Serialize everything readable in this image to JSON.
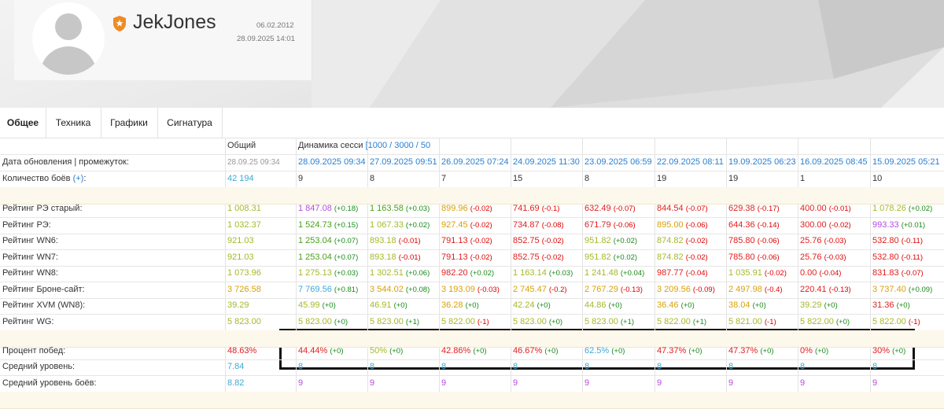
{
  "profile": {
    "username": "JekJones",
    "registered": "06.02.2012",
    "last_seen": "28.09.2025 14:01"
  },
  "tabs": [
    {
      "label": "Общее",
      "active": true
    },
    {
      "label": "Техника",
      "active": false
    },
    {
      "label": "Графики",
      "active": false
    },
    {
      "label": "Сигнатура",
      "active": false
    }
  ],
  "table": {
    "header": {
      "overall": "Общий",
      "dynamics": "Динамика сесси",
      "dynamics_link": "[1000 / 3000 / 50"
    },
    "update_row": {
      "label": "Дата обновления | промежуток:",
      "overall": "28.09.25 09:34",
      "dates": [
        "28.09.2025 09:34",
        "27.09.2025 09:51",
        "26.09.2025 07:24",
        "24.09.2025 11:30",
        "23.09.2025 06:59",
        "22.09.2025 08:11",
        "19.09.2025 06:23",
        "16.09.2025 08:45",
        "15.09.2025 05:21"
      ]
    },
    "battles_row": {
      "label": "Количество боёв",
      "plus": "(+)",
      "suffix": ":",
      "overall": "42 194",
      "values": [
        "9",
        "8",
        "7",
        "15",
        "8",
        "19",
        "19",
        "1",
        "10"
      ]
    },
    "ratings": [
      {
        "label": "Рейтинг РЭ старый:",
        "overall": "1 008.31",
        "overall_color": "#a6b82a",
        "cells": [
          {
            "v": "1 847.08",
            "c": "#b34ce0",
            "d": "(+0.18)",
            "s": "pos"
          },
          {
            "v": "1 163.58",
            "c": "#4a9e1a",
            "d": "(+0.03)",
            "s": "pos"
          },
          {
            "v": "899.96",
            "c": "#d8a10a",
            "d": "(-0.02)",
            "s": "neg"
          },
          {
            "v": "741.69",
            "c": "#e02020",
            "d": "(-0.1)",
            "s": "neg"
          },
          {
            "v": "632.49",
            "c": "#e02020",
            "d": "(-0.07)",
            "s": "neg"
          },
          {
            "v": "844.54",
            "c": "#e02020",
            "d": "(-0.07)",
            "s": "neg"
          },
          {
            "v": "629.38",
            "c": "#e02020",
            "d": "(-0.17)",
            "s": "neg"
          },
          {
            "v": "400.00",
            "c": "#e02020",
            "d": "(-0.01)",
            "s": "neg"
          },
          {
            "v": "1 078.26",
            "c": "#a6b82a",
            "d": "(+0.02)",
            "s": "pos"
          }
        ]
      },
      {
        "label": "Рейтинг РЭ:",
        "overall": "1 032.37",
        "overall_color": "#a6b82a",
        "cells": [
          {
            "v": "1 524.73",
            "c": "#4a9e1a",
            "d": "(+0.15)",
            "s": "pos"
          },
          {
            "v": "1 067.33",
            "c": "#a6b82a",
            "d": "(+0.02)",
            "s": "pos"
          },
          {
            "v": "927.45",
            "c": "#d8a10a",
            "d": "(-0.02)",
            "s": "neg"
          },
          {
            "v": "734.87",
            "c": "#e02020",
            "d": "(-0.08)",
            "s": "neg"
          },
          {
            "v": "671.79",
            "c": "#e02020",
            "d": "(-0.06)",
            "s": "neg"
          },
          {
            "v": "895.00",
            "c": "#d8a10a",
            "d": "(-0.06)",
            "s": "neg"
          },
          {
            "v": "644.36",
            "c": "#e02020",
            "d": "(-0.14)",
            "s": "neg"
          },
          {
            "v": "300.00",
            "c": "#e02020",
            "d": "(-0.02)",
            "s": "neg"
          },
          {
            "v": "993.33",
            "c": "#b34ce0",
            "d": "(+0.01)",
            "s": "pos"
          }
        ]
      },
      {
        "label": "Рейтинг WN6:",
        "overall": "921.03",
        "overall_color": "#a6b82a",
        "cells": [
          {
            "v": "1 253.04",
            "c": "#4a9e1a",
            "d": "(+0.07)",
            "s": "pos"
          },
          {
            "v": "893.18",
            "c": "#a6b82a",
            "d": "(-0.01)",
            "s": "neg"
          },
          {
            "v": "791.13",
            "c": "#e02020",
            "d": "(-0.02)",
            "s": "neg"
          },
          {
            "v": "852.75",
            "c": "#e02020",
            "d": "(-0.02)",
            "s": "neg"
          },
          {
            "v": "951.82",
            "c": "#a6b82a",
            "d": "(+0.02)",
            "s": "pos"
          },
          {
            "v": "874.82",
            "c": "#a6b82a",
            "d": "(-0.02)",
            "s": "neg"
          },
          {
            "v": "785.80",
            "c": "#e02020",
            "d": "(-0.06)",
            "s": "neg"
          },
          {
            "v": "25.76",
            "c": "#e02020",
            "d": "(-0.03)",
            "s": "neg"
          },
          {
            "v": "532.80",
            "c": "#e02020",
            "d": "(-0.11)",
            "s": "neg"
          }
        ]
      },
      {
        "label": "Рейтинг WN7:",
        "overall": "921.03",
        "overall_color": "#a6b82a",
        "cells": [
          {
            "v": "1 253.04",
            "c": "#4a9e1a",
            "d": "(+0.07)",
            "s": "pos"
          },
          {
            "v": "893.18",
            "c": "#a6b82a",
            "d": "(-0.01)",
            "s": "neg"
          },
          {
            "v": "791.13",
            "c": "#e02020",
            "d": "(-0.02)",
            "s": "neg"
          },
          {
            "v": "852.75",
            "c": "#e02020",
            "d": "(-0.02)",
            "s": "neg"
          },
          {
            "v": "951.82",
            "c": "#a6b82a",
            "d": "(+0.02)",
            "s": "pos"
          },
          {
            "v": "874.82",
            "c": "#a6b82a",
            "d": "(-0.02)",
            "s": "neg"
          },
          {
            "v": "785.80",
            "c": "#e02020",
            "d": "(-0.06)",
            "s": "neg"
          },
          {
            "v": "25.76",
            "c": "#e02020",
            "d": "(-0.03)",
            "s": "neg"
          },
          {
            "v": "532.80",
            "c": "#e02020",
            "d": "(-0.11)",
            "s": "neg"
          }
        ]
      },
      {
        "label": "Рейтинг WN8:",
        "overall": "1 073.96",
        "overall_color": "#a6b82a",
        "cells": [
          {
            "v": "1 275.13",
            "c": "#a6b82a",
            "d": "(+0.03)",
            "s": "pos"
          },
          {
            "v": "1 302.51",
            "c": "#a6b82a",
            "d": "(+0.06)",
            "s": "pos"
          },
          {
            "v": "982.20",
            "c": "#e02020",
            "d": "(+0.02)",
            "s": "pos"
          },
          {
            "v": "1 163.14",
            "c": "#a6b82a",
            "d": "(+0.03)",
            "s": "pos"
          },
          {
            "v": "1 241.48",
            "c": "#a6b82a",
            "d": "(+0.04)",
            "s": "pos"
          },
          {
            "v": "987.77",
            "c": "#e02020",
            "d": "(-0.04)",
            "s": "neg"
          },
          {
            "v": "1 035.91",
            "c": "#a6b82a",
            "d": "(-0.02)",
            "s": "neg"
          },
          {
            "v": "0.00",
            "c": "#e02020",
            "d": "(-0.04)",
            "s": "neg"
          },
          {
            "v": "831.83",
            "c": "#e02020",
            "d": "(-0.07)",
            "s": "neg"
          }
        ]
      },
      {
        "label": "Рейтинг Броне-сайт:",
        "overall": "3 726.58",
        "overall_color": "#d8a10a",
        "cells": [
          {
            "v": "7 769.56",
            "c": "#3fa8d6",
            "d": "(+0.81)",
            "s": "pos"
          },
          {
            "v": "3 544.02",
            "c": "#d8a10a",
            "d": "(+0.08)",
            "s": "pos"
          },
          {
            "v": "3 193.09",
            "c": "#d8a10a",
            "d": "(-0.03)",
            "s": "neg"
          },
          {
            "v": "2 745.47",
            "c": "#d8a10a",
            "d": "(-0.2)",
            "s": "neg"
          },
          {
            "v": "2 767.29",
            "c": "#d8a10a",
            "d": "(-0.13)",
            "s": "neg"
          },
          {
            "v": "3 209.56",
            "c": "#d8a10a",
            "d": "(-0.09)",
            "s": "neg"
          },
          {
            "v": "2 497.98",
            "c": "#d8a10a",
            "d": "(-0.4)",
            "s": "neg"
          },
          {
            "v": "220.41",
            "c": "#e02020",
            "d": "(-0.13)",
            "s": "neg"
          },
          {
            "v": "3 737.40",
            "c": "#d8a10a",
            "d": "(+0.09)",
            "s": "pos"
          }
        ]
      },
      {
        "label": "Рейтинг XVM (WN8):",
        "overall": "39.29",
        "overall_color": "#a6b82a",
        "cells": [
          {
            "v": "45.99",
            "c": "#a6b82a",
            "d": "(+0)",
            "s": "pos"
          },
          {
            "v": "46.91",
            "c": "#a6b82a",
            "d": "(+0)",
            "s": "pos"
          },
          {
            "v": "36.28",
            "c": "#d8a10a",
            "d": "(+0)",
            "s": "pos"
          },
          {
            "v": "42.24",
            "c": "#a6b82a",
            "d": "(+0)",
            "s": "pos"
          },
          {
            "v": "44.86",
            "c": "#a6b82a",
            "d": "(+0)",
            "s": "pos"
          },
          {
            "v": "36.46",
            "c": "#d8a10a",
            "d": "(+0)",
            "s": "pos"
          },
          {
            "v": "38.04",
            "c": "#d8a10a",
            "d": "(+0)",
            "s": "pos"
          },
          {
            "v": "39.29",
            "c": "#a6b82a",
            "d": "(+0)",
            "s": "pos"
          },
          {
            "v": "31.36",
            "c": "#e02020",
            "d": "(+0)",
            "s": "pos"
          }
        ]
      },
      {
        "label": "Рейтинг WG:",
        "overall": "5 823.00",
        "overall_color": "#a6b82a",
        "cells": [
          {
            "v": "5 823.00",
            "c": "#a6b82a",
            "d": "(+0)",
            "s": "pos"
          },
          {
            "v": "5 823.00",
            "c": "#a6b82a",
            "d": "(+1)",
            "s": "pos"
          },
          {
            "v": "5 822.00",
            "c": "#a6b82a",
            "d": "(-1)",
            "s": "neg"
          },
          {
            "v": "5 823.00",
            "c": "#a6b82a",
            "d": "(+0)",
            "s": "pos"
          },
          {
            "v": "5 823.00",
            "c": "#a6b82a",
            "d": "(+1)",
            "s": "pos"
          },
          {
            "v": "5 822.00",
            "c": "#a6b82a",
            "d": "(+1)",
            "s": "pos"
          },
          {
            "v": "5 821.00",
            "c": "#a6b82a",
            "d": "(-1)",
            "s": "neg"
          },
          {
            "v": "5 822.00",
            "c": "#a6b82a",
            "d": "(+0)",
            "s": "pos"
          },
          {
            "v": "5 822.00",
            "c": "#a6b82a",
            "d": "(-1)",
            "s": "neg"
          }
        ]
      }
    ],
    "winrate": {
      "label": "Процент побед:",
      "overall": "48.63%",
      "overall_color": "#e02020",
      "cells": [
        {
          "v": "44.44%",
          "c": "#e02020",
          "d": "(+0)",
          "s": "pos"
        },
        {
          "v": "50%",
          "c": "#a6b82a",
          "d": "(+0)",
          "s": "pos"
        },
        {
          "v": "42.86%",
          "c": "#e02020",
          "d": "(+0)",
          "s": "pos"
        },
        {
          "v": "46.67%",
          "c": "#e02020",
          "d": "(+0)",
          "s": "pos"
        },
        {
          "v": "62.5%",
          "c": "#3fa8d6",
          "d": "(+0)",
          "s": "pos"
        },
        {
          "v": "47.37%",
          "c": "#e02020",
          "d": "(+0)",
          "s": "pos"
        },
        {
          "v": "47.37%",
          "c": "#e02020",
          "d": "(+0)",
          "s": "pos"
        },
        {
          "v": "0%",
          "c": "#e02020",
          "d": "(+0)",
          "s": "pos"
        },
        {
          "v": "30%",
          "c": "#e02020",
          "d": "(+0)",
          "s": "pos"
        }
      ]
    },
    "avg_level": {
      "label": "Средний уровень:",
      "overall": "7.84",
      "overall_color": "#3fa8d6",
      "values": [
        "8",
        "8",
        "8",
        "8",
        "8",
        "8",
        "8",
        "8",
        "8"
      ],
      "color": "#3fa8d6"
    },
    "avg_battle_level": {
      "label": "Средний уровень боёв:",
      "overall": "8.82",
      "overall_color": "#3fa8d6",
      "values": [
        "9",
        "9",
        "9",
        "9",
        "9",
        "9",
        "9",
        "9",
        "9"
      ],
      "color": "#b34ce0"
    }
  }
}
